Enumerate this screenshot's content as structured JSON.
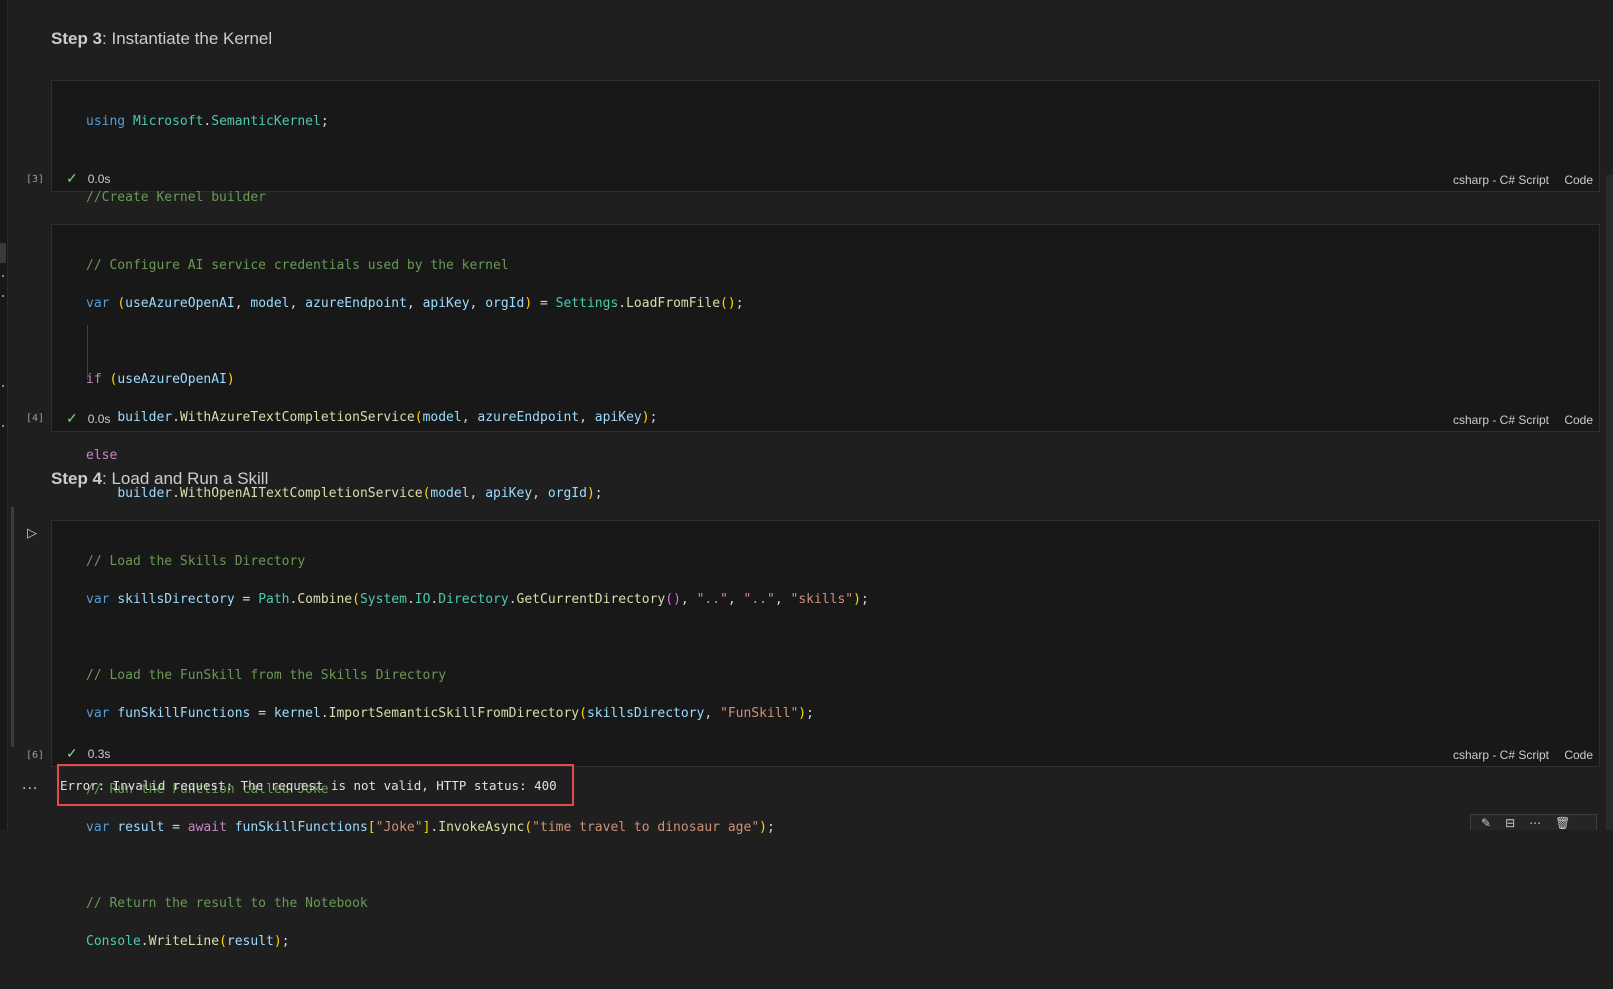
{
  "step3": {
    "bold": "Step 3",
    "rest": ": Instantiate the Kernel"
  },
  "step4": {
    "bold": "Step 4",
    "rest": ": Load and Run a Skill"
  },
  "cells": [
    {
      "exec_count": "[3]",
      "time": "0.0s",
      "language": "csharp - C# Script",
      "kind": "Code"
    },
    {
      "exec_count": "[4]",
      "time": "0.0s",
      "language": "csharp - C# Script",
      "kind": "Code"
    },
    {
      "exec_count": "[6]",
      "time": "0.3s",
      "language": "csharp - C# Script",
      "kind": "Code"
    }
  ],
  "output": {
    "error_text": "Error: Invalid request: The request is not valid, HTTP status: 400",
    "more_label": "..."
  },
  "icons": {
    "run": "play-icon",
    "check": "check-icon",
    "toolbar": [
      "edit-icon",
      "split-cell-icon",
      "more-icon",
      "delete-icon"
    ]
  },
  "colors": {
    "error_border": "#e5484d",
    "success": "#89d185",
    "keyword": "#569cd6",
    "type": "#4ec9b0",
    "comment": "#6a9955",
    "string": "#ce9178"
  }
}
